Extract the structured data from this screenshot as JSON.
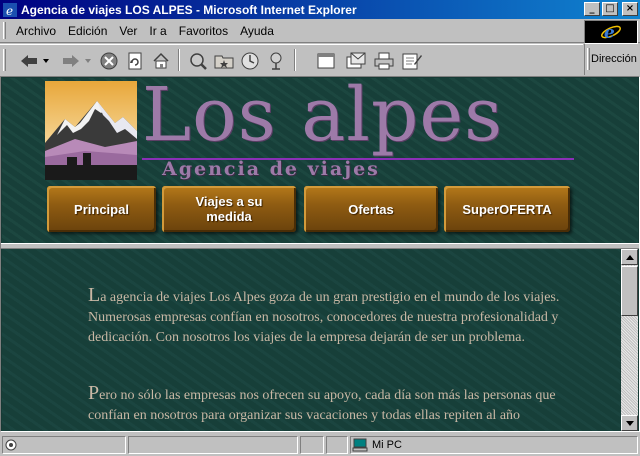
{
  "window": {
    "title": "Agencia de viajes LOS ALPES - Microsoft Internet Explorer",
    "controls": [
      "_",
      "□",
      "×"
    ]
  },
  "menu": {
    "items": [
      {
        "label": "Archivo"
      },
      {
        "label": "Edición"
      },
      {
        "label": "Ver"
      },
      {
        "label": "Ir a"
      },
      {
        "label": "Favoritos"
      },
      {
        "label": "Ayuda"
      }
    ]
  },
  "toolbar": {
    "buttons": [
      "back-icon",
      "forward-icon",
      "stop-icon",
      "refresh-icon",
      "home-icon",
      "search-icon",
      "favorites-icon",
      "history-icon",
      "channels-icon",
      "fullscreen-icon",
      "mail-icon",
      "print-icon",
      "edit-icon"
    ]
  },
  "address": {
    "label": "Dirección"
  },
  "site": {
    "title": "Los alpes",
    "subtitle": "Agencia de viajes",
    "nav": [
      {
        "label": "Principal"
      },
      {
        "label": "Viajes a su medida"
      },
      {
        "label": "Ofertas"
      },
      {
        "label": "SuperOFERTA"
      }
    ],
    "paragraphs": [
      {
        "cap": "L",
        "text": "a agencia de viajes Los Alpes goza de un gran prestigio en el mundo de los viajes. Numerosas empresas confían en nosotros, conocedores de nuestra profesionalidad y dedicación. Con nosotros los viajes de la empresa dejarán de ser un problema."
      },
      {
        "cap": "P",
        "text": "ero no sólo las empresas nos ofrecen su apoyo, cada día son más las personas que confían en nosotros para organizar sus vacaciones y todas ellas repiten al año"
      }
    ]
  },
  "status": {
    "zone": "Mi PC"
  },
  "colors": {
    "page_bg": "#163a35",
    "title_purple": "#9d7aa8",
    "button_gold": "#8f5c12",
    "text": "#c9b8a5"
  }
}
